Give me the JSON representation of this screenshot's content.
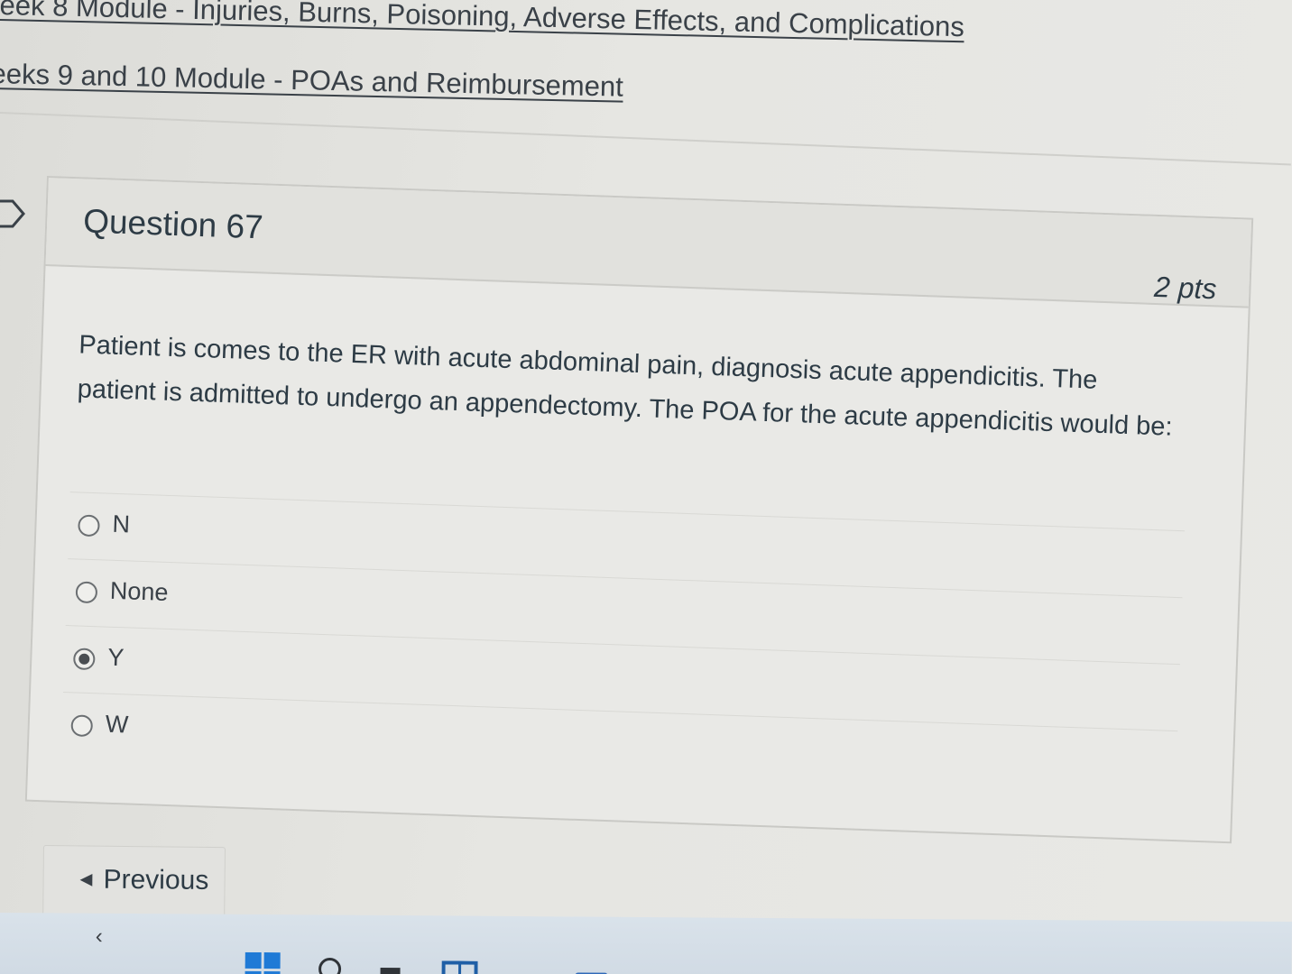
{
  "breadcrumbs": [
    {
      "label": "eek 8 Module - Injuries, Burns, Poisoning, Adverse Effects, and Complications"
    },
    {
      "label": "eeks 9 and 10 Module - POAs and Reimbursement"
    }
  ],
  "question": {
    "title": "Question 67",
    "points": "2 pts",
    "text": "Patient is comes to the ER with acute abdominal pain, diagnosis acute appendicitis. The patient is admitted to undergo an appendectomy. The POA for the acute appendicitis would be:",
    "answers": [
      {
        "label": "N",
        "selected": false
      },
      {
        "label": "None",
        "selected": false
      },
      {
        "label": "Y",
        "selected": true
      },
      {
        "label": "W",
        "selected": false
      }
    ]
  },
  "navigation": {
    "previous_label": "Previous"
  },
  "taskbar": {
    "back_glyph": "‹",
    "icons": [
      "windows-start-icon",
      "search-icon",
      "task-view-icon",
      "app-icon",
      "app-icon",
      "app-icon"
    ]
  },
  "colors": {
    "text": "#2d3b45",
    "background": "#e6e6e2",
    "taskbar": "#d3dde6",
    "windows_blue": "#1f7ad6"
  }
}
